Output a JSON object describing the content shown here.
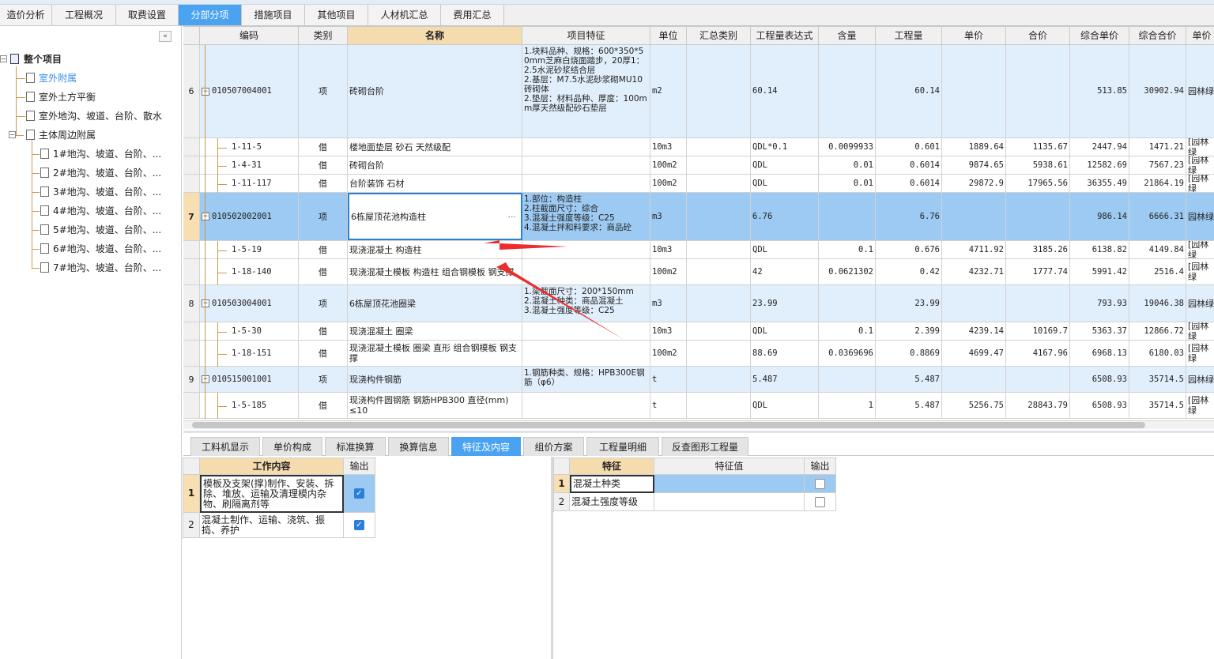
{
  "top_tabs": [
    "造价分析",
    "工程概况",
    "取费设置",
    "分部分项",
    "措施项目",
    "其他项目",
    "人材机汇总",
    "费用汇总"
  ],
  "active_top_tab": "分部分项",
  "tree": {
    "collapse_icon": "«",
    "root": "整个项目",
    "items": [
      "室外附属",
      "室外土方平衡",
      "室外地沟、坡道、台阶、散水",
      "主体周边附属"
    ],
    "children": [
      "1#地沟、坡道、台阶、...",
      "2#地沟、坡道、台阶、...",
      "3#地沟、坡道、台阶、...",
      "4#地沟、坡道、台阶、...",
      "5#地沟、坡道、台阶、...",
      "6#地沟、坡道、台阶、...",
      "7#地沟、坡道、台阶、..."
    ]
  },
  "grid": {
    "headers": [
      "编码",
      "类别",
      "名称",
      "项目特征",
      "单位",
      "汇总类别",
      "工程量表达式",
      "含量",
      "工程量",
      "单价",
      "合价",
      "综合单价",
      "综合合价",
      "单价"
    ],
    "rows": [
      {
        "no": "6",
        "code": "010507004001",
        "type": "项",
        "name": "砖砌台阶",
        "feature": "1.块料品种、规格：600*350*50mm芝麻白烧面踏步，20厚1：2.5水泥砂浆结合层\n2.基层：M7.5水泥砂浆砌MU10砖砌体\n2.垫层：材料品种、厚度：100mm厚天然级配砂石垫层",
        "unit": "m2",
        "sum_type": "",
        "expr": "60.14",
        "content": "",
        "qty": "60.14",
        "price": "",
        "total": "",
        "comp_price": "513.85",
        "comp_total": "30902.94",
        "extra": "园林绿"
      },
      {
        "no": "",
        "code": "1-11-5",
        "type": "借",
        "name": "楼地面垫层 砂石 天然级配",
        "feature": "",
        "unit": "10m3",
        "sum_type": "",
        "expr": "QDL*0.1",
        "content": "0.0099933",
        "qty": "0.601",
        "price": "1889.64",
        "total": "1135.67",
        "comp_price": "2447.94",
        "comp_total": "1471.21",
        "extra": "[园林绿"
      },
      {
        "no": "",
        "code": "1-4-31",
        "type": "借",
        "name": "砖砌台阶",
        "feature": "",
        "unit": "100m2",
        "sum_type": "",
        "expr": "QDL",
        "content": "0.01",
        "qty": "0.6014",
        "price": "9874.65",
        "total": "5938.61",
        "comp_price": "12582.69",
        "comp_total": "7567.23",
        "extra": "[园林绿"
      },
      {
        "no": "",
        "code": "1-11-117",
        "type": "借",
        "name": "台阶装饰 石材",
        "feature": "",
        "unit": "100m2",
        "sum_type": "",
        "expr": "QDL",
        "content": "0.01",
        "qty": "0.6014",
        "price": "29872.9",
        "total": "17965.56",
        "comp_price": "36355.49",
        "comp_total": "21864.19",
        "extra": "[园林绿"
      },
      {
        "no": "7",
        "code": "010502002001",
        "type": "项",
        "name": "6栋屋顶花池构造柱",
        "feature": "1.部位：构造柱\n2.柱截面尺寸：综合\n3.混凝土强度等级：C25\n4.混凝土拌和料要求：商品砼",
        "unit": "m3",
        "sum_type": "",
        "expr": "6.76",
        "content": "",
        "qty": "6.76",
        "price": "",
        "total": "",
        "comp_price": "986.14",
        "comp_total": "6666.31",
        "extra": "园林绿"
      },
      {
        "no": "",
        "code": "1-5-19",
        "type": "借",
        "name": "现浇混凝土 构造柱",
        "feature": "",
        "unit": "10m3",
        "sum_type": "",
        "expr": "QDL",
        "content": "0.1",
        "qty": "0.676",
        "price": "4711.92",
        "total": "3185.26",
        "comp_price": "6138.82",
        "comp_total": "4149.84",
        "extra": "[园林绿"
      },
      {
        "no": "",
        "code": "1-18-140",
        "type": "借",
        "name": "现浇混凝土模板 构造柱 组合钢模板 钢支撑",
        "feature": "",
        "unit": "100m2",
        "sum_type": "",
        "expr": "42",
        "content": "0.0621302",
        "qty": "0.42",
        "price": "4232.71",
        "total": "1777.74",
        "comp_price": "5991.42",
        "comp_total": "2516.4",
        "extra": "[园林绿"
      },
      {
        "no": "8",
        "code": "010503004001",
        "type": "项",
        "name": "6栋屋顶花池圈梁",
        "feature": "1.梁截面尺寸：200*150mm\n2.混凝土种类：商品混凝土\n3.混凝土强度等级：C25",
        "unit": "m3",
        "sum_type": "",
        "expr": "23.99",
        "content": "",
        "qty": "23.99",
        "price": "",
        "total": "",
        "comp_price": "793.93",
        "comp_total": "19046.38",
        "extra": "园林绿"
      },
      {
        "no": "",
        "code": "1-5-30",
        "type": "借",
        "name": "现浇混凝土 圈梁",
        "feature": "",
        "unit": "10m3",
        "sum_type": "",
        "expr": "QDL",
        "content": "0.1",
        "qty": "2.399",
        "price": "4239.14",
        "total": "10169.7",
        "comp_price": "5363.37",
        "comp_total": "12866.72",
        "extra": "[园林绿"
      },
      {
        "no": "",
        "code": "1-18-151",
        "type": "借",
        "name": "现浇混凝土模板 圈梁 直形 组合钢模板 钢支撑",
        "feature": "",
        "unit": "100m2",
        "sum_type": "",
        "expr": "88.69",
        "content": "0.0369696",
        "qty": "0.8869",
        "price": "4699.47",
        "total": "4167.96",
        "comp_price": "6968.13",
        "comp_total": "6180.03",
        "extra": "[园林绿"
      },
      {
        "no": "9",
        "code": "010515001001",
        "type": "项",
        "name": "现浇构件钢筋",
        "feature": "1.钢筋种类、规格：HPB300E钢筋（φ6）",
        "unit": "t",
        "sum_type": "",
        "expr": "5.487",
        "content": "",
        "qty": "5.487",
        "price": "",
        "total": "",
        "comp_price": "6508.93",
        "comp_total": "35714.5",
        "extra": "园林绿"
      },
      {
        "no": "",
        "code": "1-5-185",
        "type": "借",
        "name": "现浇构件圆钢筋 钢筋HPB300 直径(mm) ≤10",
        "feature": "",
        "unit": "t",
        "sum_type": "",
        "expr": "QDL",
        "content": "1",
        "qty": "5.487",
        "price": "5256.75",
        "total": "28843.79",
        "comp_price": "6508.93",
        "comp_total": "35714.5",
        "extra": "[园林绿"
      }
    ],
    "ellipsis": "···"
  },
  "bottom_tabs": [
    "工料机显示",
    "单价构成",
    "标准换算",
    "换算信息",
    "特征及内容",
    "组价方案",
    "工程量明细",
    "反查图形工程量"
  ],
  "active_bottom_tab": "特征及内容",
  "work": {
    "headers": [
      "工作内容",
      "输出"
    ],
    "rows": [
      {
        "no": "1",
        "text": "模板及支架(撑)制作、安装、拆除、堆放、运输及清理模内杂物、刷隔离剂等",
        "checked": true
      },
      {
        "no": "2",
        "text": "混凝土制作、运输、浇筑、振捣、养护",
        "checked": true
      }
    ]
  },
  "feature_table": {
    "headers": [
      "特征",
      "特征值",
      "输出"
    ],
    "rows": [
      {
        "no": "1",
        "name": "混凝土种类",
        "value": "",
        "checked": false
      },
      {
        "no": "2",
        "name": "混凝土强度等级",
        "value": "",
        "checked": false
      }
    ]
  },
  "colors": {
    "accent": "#4aa3f0",
    "arrow": "#ee2c2c",
    "selected_row": "#9dcaf2",
    "item_row": "#e1eefb",
    "header_name": "#f5dcae"
  }
}
